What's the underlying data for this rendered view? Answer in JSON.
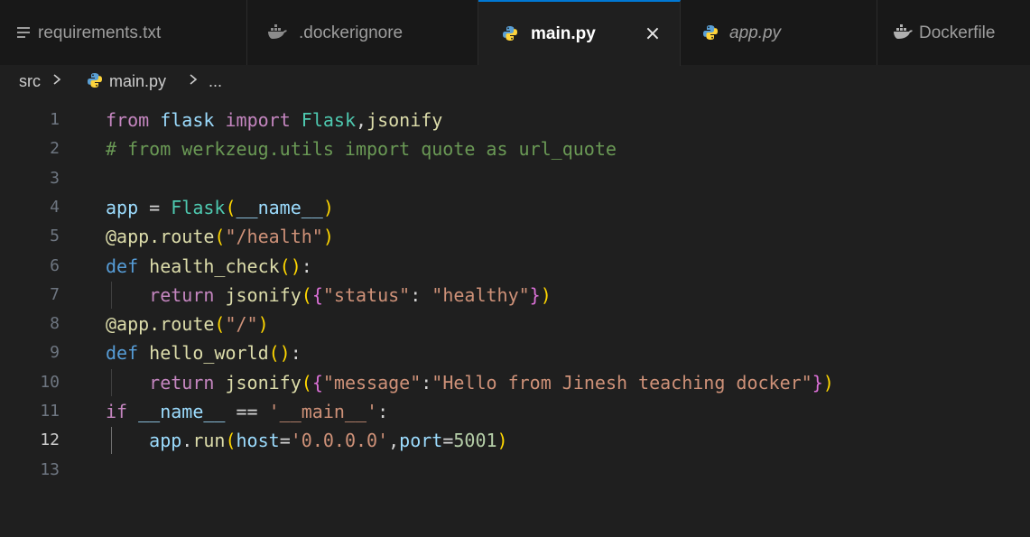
{
  "colors": {
    "background": "#1f1f1f",
    "tabbar": "#181818",
    "active_tab_accent": "#0078d4",
    "keyword": "#c586c0",
    "keyword_def": "#569cd6",
    "class": "#4ec9b0",
    "function": "#dcdcaa",
    "variable": "#9cdcfe",
    "string": "#ce9178",
    "number": "#b5cea8",
    "comment": "#6a9955",
    "bracket_level_1": "#ffd700",
    "bracket_level_2": "#da70d6",
    "bracket_level_3": "#179fff"
  },
  "tabs": [
    {
      "label": "requirements.txt",
      "icon": "text-lines-icon",
      "active": false,
      "italic": false
    },
    {
      "label": ".dockerignore",
      "icon": "docker-whale-icon",
      "active": false,
      "italic": false
    },
    {
      "label": "main.py",
      "icon": "python-icon",
      "active": true,
      "italic": false,
      "close": "×"
    },
    {
      "label": "app.py",
      "icon": "python-icon",
      "active": false,
      "italic": true
    },
    {
      "label": "Dockerfile",
      "icon": "docker-whale-icon",
      "active": false,
      "italic": false
    }
  ],
  "breadcrumb": {
    "folder": "src",
    "file": "main.py",
    "file_icon": "python-icon",
    "more": "..."
  },
  "editor": {
    "current_line": 12,
    "lines": [
      {
        "n": "1",
        "tokens": [
          [
            "from",
            "kw"
          ],
          [
            " ",
            ""
          ],
          [
            "flask",
            "var-plain"
          ],
          [
            " ",
            ""
          ],
          [
            "import",
            "kw"
          ],
          [
            " ",
            ""
          ],
          [
            "Flask",
            "cls"
          ],
          [
            ",",
            "op"
          ],
          [
            "jsonify",
            "fn"
          ]
        ]
      },
      {
        "n": "2",
        "tokens": [
          [
            "# from werkzeug.utils import quote as url_quote",
            "cmt"
          ]
        ]
      },
      {
        "n": "3",
        "tokens": []
      },
      {
        "n": "4",
        "tokens": [
          [
            "app",
            "var"
          ],
          [
            " = ",
            "op"
          ],
          [
            "Flask",
            "cls"
          ],
          [
            "(",
            "p1"
          ],
          [
            "__name__",
            "var"
          ],
          [
            ")",
            "p1"
          ]
        ]
      },
      {
        "n": "5",
        "tokens": [
          [
            "@app.route",
            "fn"
          ],
          [
            "(",
            "p1"
          ],
          [
            "\"/health\"",
            "str"
          ],
          [
            ")",
            "p1"
          ]
        ]
      },
      {
        "n": "6",
        "tokens": [
          [
            "def",
            "kw2"
          ],
          [
            " ",
            ""
          ],
          [
            "health_check",
            "fn"
          ],
          [
            "()",
            "p1"
          ],
          [
            ":",
            "op"
          ]
        ]
      },
      {
        "n": "7",
        "tokens": [
          [
            "    ",
            ""
          ],
          [
            "return",
            "kw"
          ],
          [
            " ",
            ""
          ],
          [
            "jsonify",
            "fn"
          ],
          [
            "(",
            "p1"
          ],
          [
            "{",
            "p2"
          ],
          [
            "\"status\"",
            "str"
          ],
          [
            ": ",
            "op"
          ],
          [
            "\"healthy\"",
            "str"
          ],
          [
            "}",
            "p2"
          ],
          [
            ")",
            "p1"
          ]
        ],
        "guide": true
      },
      {
        "n": "8",
        "tokens": [
          [
            "@app.route",
            "fn"
          ],
          [
            "(",
            "p1"
          ],
          [
            "\"/\"",
            "str"
          ],
          [
            ")",
            "p1"
          ]
        ]
      },
      {
        "n": "9",
        "tokens": [
          [
            "def",
            "kw2"
          ],
          [
            " ",
            ""
          ],
          [
            "hello_world",
            "fn"
          ],
          [
            "()",
            "p1"
          ],
          [
            ":",
            "op"
          ]
        ]
      },
      {
        "n": "10",
        "tokens": [
          [
            "    ",
            ""
          ],
          [
            "return",
            "kw"
          ],
          [
            " ",
            ""
          ],
          [
            "jsonify",
            "fn"
          ],
          [
            "(",
            "p1"
          ],
          [
            "{",
            "p2"
          ],
          [
            "\"message\"",
            "str"
          ],
          [
            ":",
            "op"
          ],
          [
            "\"Hello from Jinesh teaching docker\"",
            "str"
          ],
          [
            "}",
            "p2"
          ],
          [
            ")",
            "p1"
          ]
        ],
        "guide": true
      },
      {
        "n": "11",
        "tokens": [
          [
            "if",
            "kw"
          ],
          [
            " ",
            ""
          ],
          [
            "__name__",
            "var"
          ],
          [
            " == ",
            "op"
          ],
          [
            "'__main__'",
            "str"
          ],
          [
            ":",
            "op"
          ]
        ]
      },
      {
        "n": "12",
        "tokens": [
          [
            "    ",
            ""
          ],
          [
            "app",
            "var"
          ],
          [
            ".",
            "op"
          ],
          [
            "run",
            "fn"
          ],
          [
            "(",
            "p1"
          ],
          [
            "host",
            "var"
          ],
          [
            "=",
            "op"
          ],
          [
            "'0.0.0.0'",
            "str"
          ],
          [
            ",",
            "op"
          ],
          [
            "port",
            "var"
          ],
          [
            "=",
            "op"
          ],
          [
            "5001",
            "num"
          ],
          [
            ")",
            "p1"
          ]
        ],
        "guide": true,
        "guide_active": true
      },
      {
        "n": "13",
        "tokens": []
      }
    ]
  }
}
